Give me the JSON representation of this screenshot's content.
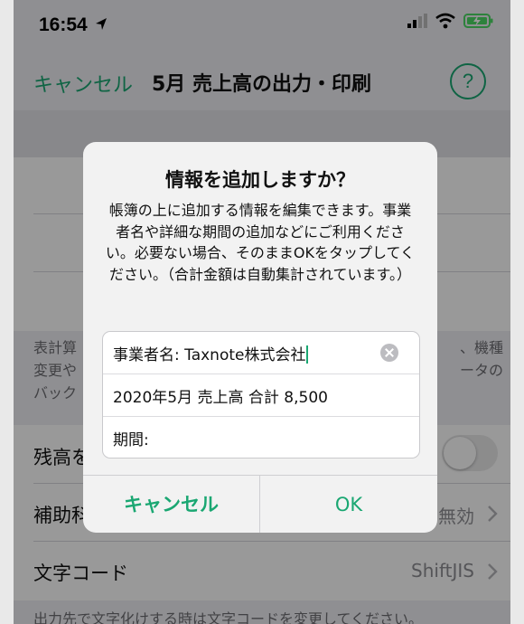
{
  "status": {
    "time": "16:54"
  },
  "nav": {
    "cancel": "キャンセル",
    "title": "5月 売上高の出力・印刷",
    "help": "?"
  },
  "background": {
    "footer_lines": [
      "表計算",
      "変更や",
      "バック"
    ],
    "footer_right_lines": [
      "、機種",
      "ータの"
    ],
    "rows": [
      {
        "label": "残高を"
      },
      {
        "label": "補助科",
        "value": "無効"
      },
      {
        "label": "文字コード",
        "value": "ShiftJIS"
      }
    ],
    "bottom_note": "出力先で文字化けする時は文字コードを変更してください。"
  },
  "alert": {
    "title": "情報を追加しますか？",
    "message": "帳簿の上に追加する情報を編集できます。事業者名や詳細な期間の追加などにご利用ください。必要ない場合、そのままOKをタップしてください。（合計金額は自動集計されています。）",
    "fields": [
      {
        "value": "事業者名: Taxnote株式会社"
      },
      {
        "value": "2020年5月 売上高 合計 8,500"
      },
      {
        "value": "期間:"
      }
    ],
    "cancel": "キャンセル",
    "ok": "OK"
  },
  "colors": {
    "accent": "#1aa772",
    "battery": "#4cd964"
  }
}
